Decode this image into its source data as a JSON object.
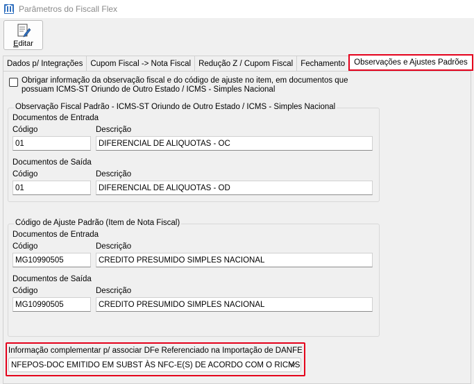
{
  "window": {
    "title": "Parâmetros do Fiscall Flex",
    "icon": "building-icon"
  },
  "toolbar": {
    "edit_label_underlined": "E",
    "edit_label_rest": "ditar",
    "edit_icon": "edit-document-icon"
  },
  "tabs": [
    {
      "label": "Dados p/ Integrações"
    },
    {
      "label": "Cupom Fiscal -> Nota Fiscal"
    },
    {
      "label": "Redução Z / Cupom Fiscal"
    },
    {
      "label": "Fechamento"
    },
    {
      "label": "Observações e Ajustes Padrões",
      "active": true
    }
  ],
  "checkbox": {
    "label": "Obrigar informação da observação fiscal e do código de ajuste no item, em documentos que possuam ICMS-ST Oriundo de Outro Estado / ICMS - Simples Nacional",
    "checked": false
  },
  "obs_group": {
    "title": "Observação Fiscal Padrão - ICMS-ST Oriundo de Outro Estado / ICMS - Simples Nacional",
    "entrada": {
      "heading": "Documentos de Entrada",
      "codigo_label": "Código",
      "descricao_label": "Descrição",
      "codigo": "01",
      "descricao": "DIFERENCIAL DE ALIQUOTAS - OC"
    },
    "saida": {
      "heading": "Documentos de Saída",
      "codigo_label": "Código",
      "descricao_label": "Descrição",
      "codigo": "01",
      "descricao": "DIFERENCIAL DE ALIQUOTAS - OD"
    }
  },
  "ajuste_group": {
    "title": "Código de Ajuste Padrão (Item de Nota Fiscal)",
    "entrada": {
      "heading": "Documentos de Entrada",
      "codigo_label": "Código",
      "descricao_label": "Descrição",
      "codigo": "MG10990505",
      "descricao": "CREDITO PRESUMIDO SIMPLES NACIONAL"
    },
    "saida": {
      "heading": "Documentos de Saída",
      "codigo_label": "Código",
      "descricao_label": "Descrição",
      "codigo": "MG10990505",
      "descricao": "CREDITO PRESUMIDO SIMPLES NACIONAL"
    }
  },
  "complementar": {
    "label": "Informação complementar p/ associar DFe Referenciado na Importação de DANFE",
    "selected": "NFEPOS-DOC EMITIDO EM SUBST ÀS NFC-E(S) DE ACORDO COM O RICMS"
  },
  "colors": {
    "highlight": "#e4001b",
    "panel_bg": "#f0f0f0"
  }
}
